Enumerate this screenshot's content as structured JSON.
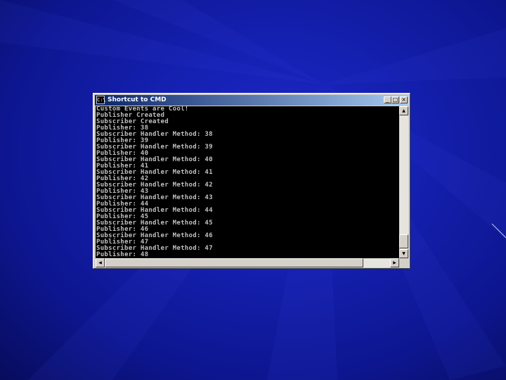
{
  "window": {
    "title": "Shortcut to CMD",
    "icon": "C:\\",
    "minimize_label": "_",
    "maximize_label": "□",
    "close_label": "×"
  },
  "console": {
    "lines": [
      "Custom Events are Cool!",
      "Publisher Created",
      "Subscriber Created",
      "Publisher: 38",
      "Subscriber Handler Method: 38",
      "Publisher: 39",
      "Subscriber Handler Method: 39",
      "Publisher: 40",
      "Subscriber Handler Method: 40",
      "Publisher: 41",
      "Subscriber Handler Method: 41",
      "Publisher: 42",
      "Subscriber Handler Method: 42",
      "Publisher: 43",
      "Subscriber Handler Method: 43",
      "Publisher: 44",
      "Subscriber Handler Method: 44",
      "Publisher: 45",
      "Subscriber Handler Method: 45",
      "Publisher: 46",
      "Subscriber Handler Method: 46",
      "Publisher: 47",
      "Subscriber Handler Method: 47",
      "Publisher: 48"
    ]
  },
  "scrollbars": {
    "up_arrow": "▲",
    "down_arrow": "▼",
    "left_arrow": "◀",
    "right_arrow": "▶"
  },
  "colors": {
    "desktop": "#1420b0",
    "titlebar_start": "#0a246a",
    "titlebar_end": "#a6caf0",
    "console_bg": "#000000",
    "console_text": "#c0c0c0"
  }
}
